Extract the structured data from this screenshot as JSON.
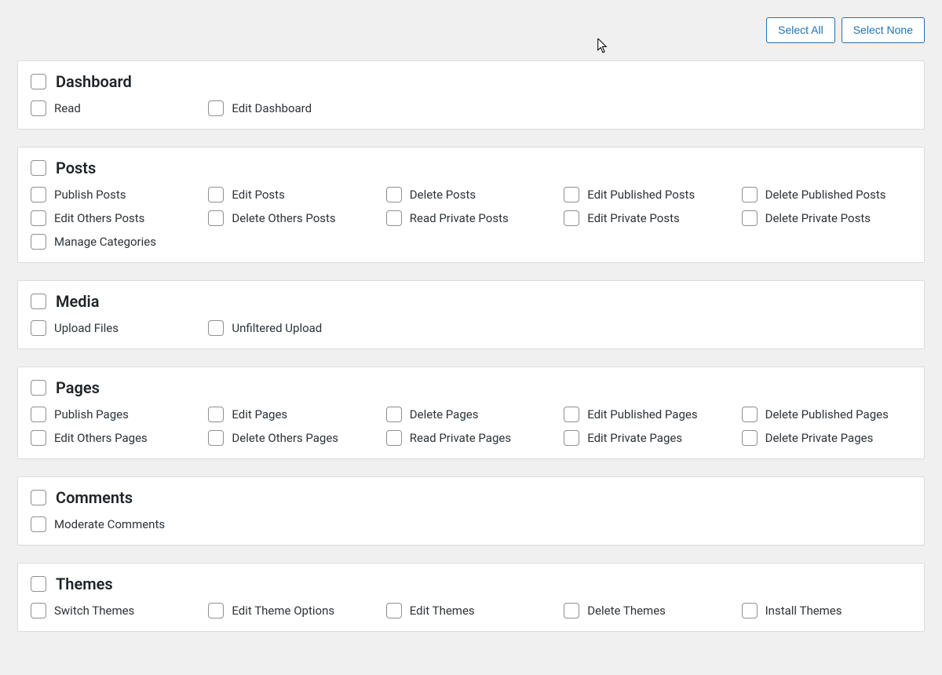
{
  "actions": {
    "select_all": "Select All",
    "select_none": "Select None"
  },
  "groups": [
    {
      "title": "Dashboard",
      "caps": [
        "Read",
        "Edit Dashboard"
      ]
    },
    {
      "title": "Posts",
      "caps": [
        "Publish Posts",
        "Edit Posts",
        "Delete Posts",
        "Edit Published Posts",
        "Delete Published Posts",
        "Edit Others Posts",
        "Delete Others Posts",
        "Read Private Posts",
        "Edit Private Posts",
        "Delete Private Posts",
        "Manage Categories"
      ]
    },
    {
      "title": "Media",
      "caps": [
        "Upload Files",
        "Unfiltered Upload"
      ]
    },
    {
      "title": "Pages",
      "caps": [
        "Publish Pages",
        "Edit Pages",
        "Delete Pages",
        "Edit Published Pages",
        "Delete Published Pages",
        "Edit Others Pages",
        "Delete Others Pages",
        "Read Private Pages",
        "Edit Private Pages",
        "Delete Private Pages"
      ]
    },
    {
      "title": "Comments",
      "caps": [
        "Moderate Comments"
      ]
    },
    {
      "title": "Themes",
      "caps": [
        "Switch Themes",
        "Edit Theme Options",
        "Edit Themes",
        "Delete Themes",
        "Install Themes"
      ]
    }
  ]
}
